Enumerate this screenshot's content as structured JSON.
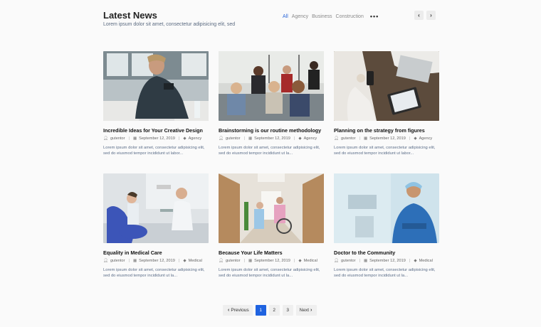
{
  "header": {
    "title": "Latest News",
    "subtitle": "Lorem ipsum dolor sit amet, consectetur adipisicing elit, sed"
  },
  "filters": [
    "All",
    "Agency",
    "Business",
    "Construction"
  ],
  "filters_more": "•••",
  "arrows": {
    "prev": "‹",
    "next": "›"
  },
  "posts": [
    {
      "title": "Incredible Ideas for Your Creative Design",
      "author": "gutentor",
      "date": "September 12, 2019",
      "category": "Agency",
      "excerpt": "Lorem ipsum dolor sit amet, consectetur adipisicing elit, sed do eiusmod tempor incididunt ut labor..."
    },
    {
      "title": "Brainstorming is our routine methodology",
      "author": "gutentor",
      "date": "September 12, 2019",
      "category": "Agency",
      "excerpt": "Lorem ipsum dolor sit amet, consectetur adipisicing elit, sed do eiusmod tempor incididunt ut la..."
    },
    {
      "title": "Planning on the strategy from figures",
      "author": "gutentor",
      "date": "September 12, 2019",
      "category": "Agency",
      "excerpt": "Lorem ipsum dolor sit amet, consectetur adipisicing elit, sed do eiusmod tempor incididunt ut labor..."
    },
    {
      "title": "Equality in Medical Care",
      "author": "gutentor",
      "date": "September 12, 2019",
      "category": "Medical",
      "excerpt": "Lorem ipsum dolor sit amet, consectetur adipisicing elit, sed do eiusmod tempor incididunt ut la..."
    },
    {
      "title": "Because Your Life Matters",
      "author": "gutentor",
      "date": "September 12, 2019",
      "category": "Medical",
      "excerpt": "Lorem ipsum dolor sit amet, consectetur adipisicing elit, sed do eiusmod tempor incididunt ut la..."
    },
    {
      "title": "Doctor to the Community",
      "author": "gutentor",
      "date": "September 12, 2019",
      "category": "Medical",
      "excerpt": "Lorem ipsum dolor sit amet, consectetur adipisicing elit, sed do eiusmod tempor incididunt ut la..."
    }
  ],
  "pagination": {
    "prev": "Previous",
    "pages": [
      "1",
      "2",
      "3"
    ],
    "current": "1",
    "next": "Next"
  },
  "colors": {
    "accent": "#1f63e0",
    "filter_active": "#2a66d9"
  }
}
